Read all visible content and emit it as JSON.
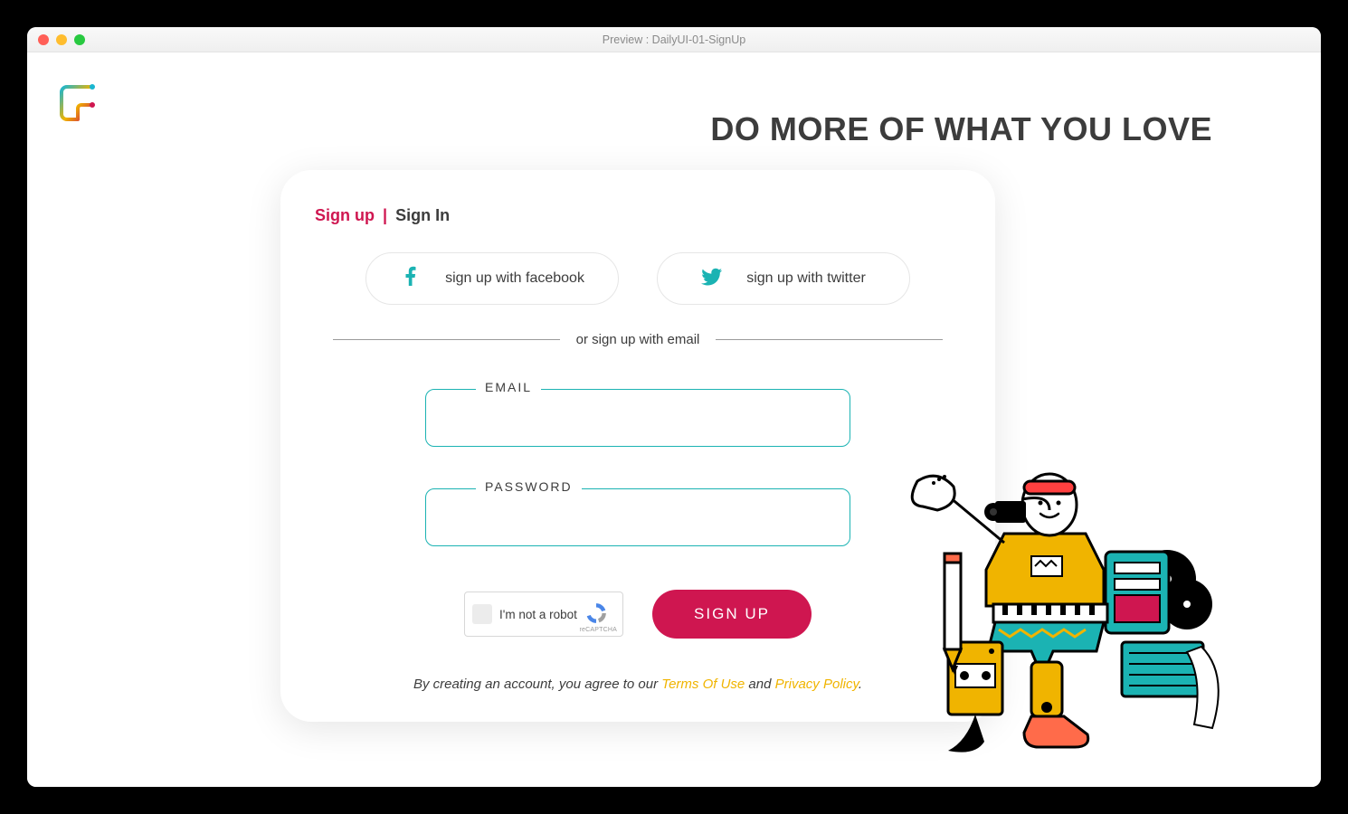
{
  "window": {
    "title": "Preview : DailyUI-01-SignUp"
  },
  "slogan": "DO MORE OF WHAT YOU LOVE",
  "tabs": {
    "active": "Sign up",
    "separator": "|",
    "other": "Sign In"
  },
  "social": {
    "facebook": "sign up with facebook",
    "twitter": "sign up with twitter"
  },
  "divider": "or sign up with email",
  "fields": {
    "email_label": "EMAIL",
    "password_label": "PASSWORD",
    "email_value": "",
    "password_value": ""
  },
  "captcha": {
    "text": "I'm not a robot",
    "sub": "reCAPTCHA"
  },
  "primary_button": "SIGN UP",
  "legal": {
    "prefix": "By creating an account, you agree to our ",
    "terms": "Terms Of Use",
    "mid": " and ",
    "privacy": "Privacy Policy",
    "suffix": "."
  },
  "colors": {
    "accent_pink": "#cf1650",
    "accent_teal": "#1bb3b3",
    "link_gold": "#f0b400"
  }
}
